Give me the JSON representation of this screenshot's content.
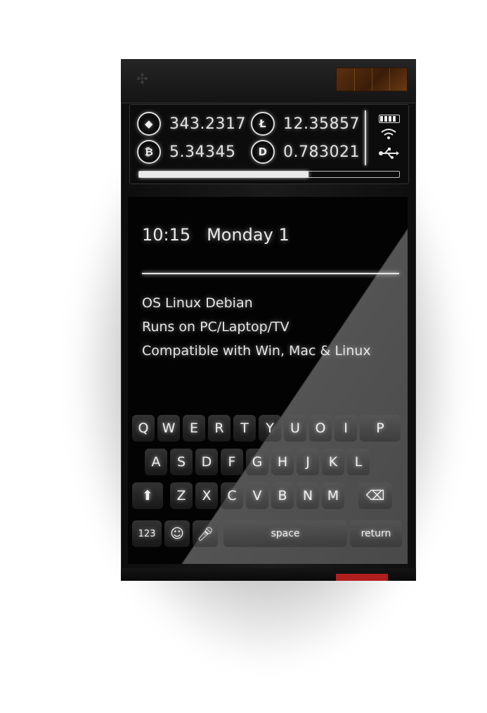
{
  "ticker": {
    "eth": {
      "icon": "ethereum-icon",
      "value": "343.2317"
    },
    "ltc": {
      "icon": "litecoin-icon",
      "value": "12.35857"
    },
    "btc": {
      "icon": "bitcoin-icon",
      "value": "5.34345"
    },
    "dash": {
      "icon": "dash-icon",
      "value": "0.783021"
    },
    "progress": 0.65
  },
  "status": {
    "battery_icon": "battery-icon",
    "wifi_icon": "wifi-icon",
    "usb_icon": "usb-icon"
  },
  "screen": {
    "time": "10:15",
    "date": "Monday 1",
    "lines": [
      "OS Linux Debian",
      "Runs on PC/Laptop/TV",
      "Compatible with Win, Mac & Linux"
    ]
  },
  "keyboard": {
    "row1": [
      "Q",
      "W",
      "E",
      "R",
      "T",
      "Y",
      "U",
      "O",
      "I",
      "P"
    ],
    "row2": [
      "A",
      "S",
      "D",
      "F",
      "G",
      "H",
      "J",
      "K",
      "L"
    ],
    "row3": [
      "Z",
      "X",
      "C",
      "V",
      "B",
      "N",
      "M"
    ],
    "numbers": "123",
    "space": "space",
    "return": "return",
    "shift_icon": "shift-icon",
    "backspace_icon": "backspace-icon",
    "emoji_icon": "emoji-icon",
    "mic_icon": "microphone-icon"
  },
  "colors": {
    "accent_red": "#b01e1e",
    "solar": "#5a2f10"
  }
}
